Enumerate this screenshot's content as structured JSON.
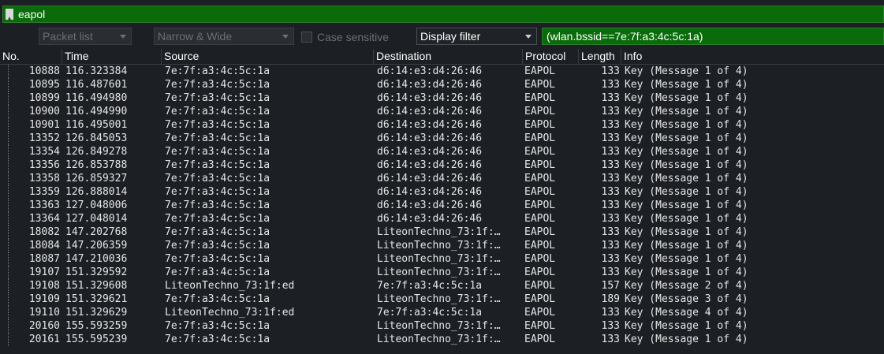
{
  "search": {
    "value": "eapol"
  },
  "toolbar": {
    "packet_list": "Packet list",
    "narrow_wide": "Narrow & Wide",
    "case_sensitive": "Case sensitive",
    "display_filter": "Display filter",
    "filter_value": "(wlan.bssid==7e:7f:a3:4c:5c:1a)"
  },
  "columns": [
    "No.",
    "Time",
    "Source",
    "Destination",
    "Protocol",
    "Length",
    "Info"
  ],
  "rows": [
    {
      "no": "10888",
      "time": "116.323384",
      "src": "7e:7f:a3:4c:5c:1a",
      "dst": "d6:14:e3:d4:26:46",
      "proto": "EAPOL",
      "len": "133",
      "info": "Key (Message 1 of 4)"
    },
    {
      "no": "10895",
      "time": "116.487601",
      "src": "7e:7f:a3:4c:5c:1a",
      "dst": "d6:14:e3:d4:26:46",
      "proto": "EAPOL",
      "len": "133",
      "info": "Key (Message 1 of 4)"
    },
    {
      "no": "10899",
      "time": "116.494980",
      "src": "7e:7f:a3:4c:5c:1a",
      "dst": "d6:14:e3:d4:26:46",
      "proto": "EAPOL",
      "len": "133",
      "info": "Key (Message 1 of 4)"
    },
    {
      "no": "10900",
      "time": "116.494990",
      "src": "7e:7f:a3:4c:5c:1a",
      "dst": "d6:14:e3:d4:26:46",
      "proto": "EAPOL",
      "len": "133",
      "info": "Key (Message 1 of 4)"
    },
    {
      "no": "10901",
      "time": "116.495001",
      "src": "7e:7f:a3:4c:5c:1a",
      "dst": "d6:14:e3:d4:26:46",
      "proto": "EAPOL",
      "len": "133",
      "info": "Key (Message 1 of 4)"
    },
    {
      "no": "13352",
      "time": "126.845053",
      "src": "7e:7f:a3:4c:5c:1a",
      "dst": "d6:14:e3:d4:26:46",
      "proto": "EAPOL",
      "len": "133",
      "info": "Key (Message 1 of 4)"
    },
    {
      "no": "13354",
      "time": "126.849278",
      "src": "7e:7f:a3:4c:5c:1a",
      "dst": "d6:14:e3:d4:26:46",
      "proto": "EAPOL",
      "len": "133",
      "info": "Key (Message 1 of 4)"
    },
    {
      "no": "13356",
      "time": "126.853788",
      "src": "7e:7f:a3:4c:5c:1a",
      "dst": "d6:14:e3:d4:26:46",
      "proto": "EAPOL",
      "len": "133",
      "info": "Key (Message 1 of 4)"
    },
    {
      "no": "13358",
      "time": "126.859327",
      "src": "7e:7f:a3:4c:5c:1a",
      "dst": "d6:14:e3:d4:26:46",
      "proto": "EAPOL",
      "len": "133",
      "info": "Key (Message 1 of 4)"
    },
    {
      "no": "13359",
      "time": "126.888014",
      "src": "7e:7f:a3:4c:5c:1a",
      "dst": "d6:14:e3:d4:26:46",
      "proto": "EAPOL",
      "len": "133",
      "info": "Key (Message 1 of 4)"
    },
    {
      "no": "13363",
      "time": "127.048006",
      "src": "7e:7f:a3:4c:5c:1a",
      "dst": "d6:14:e3:d4:26:46",
      "proto": "EAPOL",
      "len": "133",
      "info": "Key (Message 1 of 4)"
    },
    {
      "no": "13364",
      "time": "127.048014",
      "src": "7e:7f:a3:4c:5c:1a",
      "dst": "d6:14:e3:d4:26:46",
      "proto": "EAPOL",
      "len": "133",
      "info": "Key (Message 1 of 4)"
    },
    {
      "no": "18082",
      "time": "147.202768",
      "src": "7e:7f:a3:4c:5c:1a",
      "dst": "LiteonTechno_73:1f:…",
      "proto": "EAPOL",
      "len": "133",
      "info": "Key (Message 1 of 4)"
    },
    {
      "no": "18084",
      "time": "147.206359",
      "src": "7e:7f:a3:4c:5c:1a",
      "dst": "LiteonTechno_73:1f:…",
      "proto": "EAPOL",
      "len": "133",
      "info": "Key (Message 1 of 4)"
    },
    {
      "no": "18087",
      "time": "147.210036",
      "src": "7e:7f:a3:4c:5c:1a",
      "dst": "LiteonTechno_73:1f:…",
      "proto": "EAPOL",
      "len": "133",
      "info": "Key (Message 1 of 4)"
    },
    {
      "no": "19107",
      "time": "151.329592",
      "src": "7e:7f:a3:4c:5c:1a",
      "dst": "LiteonTechno_73:1f:…",
      "proto": "EAPOL",
      "len": "133",
      "info": "Key (Message 1 of 4)"
    },
    {
      "no": "19108",
      "time": "151.329608",
      "src": "LiteonTechno_73:1f:ed",
      "dst": "7e:7f:a3:4c:5c:1a",
      "proto": "EAPOL",
      "len": "157",
      "info": "Key (Message 2 of 4)"
    },
    {
      "no": "19109",
      "time": "151.329621",
      "src": "7e:7f:a3:4c:5c:1a",
      "dst": "LiteonTechno_73:1f:…",
      "proto": "EAPOL",
      "len": "189",
      "info": "Key (Message 3 of 4)"
    },
    {
      "no": "19110",
      "time": "151.329629",
      "src": "LiteonTechno_73:1f:ed",
      "dst": "7e:7f:a3:4c:5c:1a",
      "proto": "EAPOL",
      "len": "133",
      "info": "Key (Message 4 of 4)"
    },
    {
      "no": "20160",
      "time": "155.593259",
      "src": "7e:7f:a3:4c:5c:1a",
      "dst": "LiteonTechno_73:1f:…",
      "proto": "EAPOL",
      "len": "133",
      "info": "Key (Message 1 of 4)"
    },
    {
      "no": "20161",
      "time": "155.595239",
      "src": "7e:7f:a3:4c:5c:1a",
      "dst": "LiteonTechno_73:1f:…",
      "proto": "EAPOL",
      "len": "133",
      "info": "Key (Message 1 of 4)"
    }
  ]
}
